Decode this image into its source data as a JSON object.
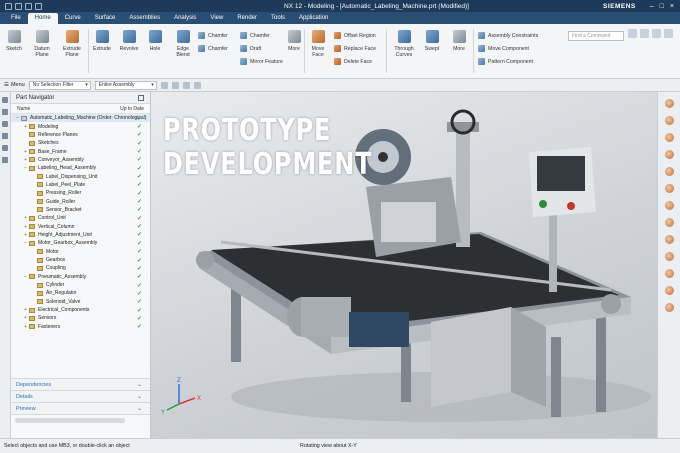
{
  "window": {
    "title": "NX 12 - Modeling - [Automatic_Labeling_Machine.prt (Modified)]",
    "brand": "SIEMENS"
  },
  "menu": {
    "tabs": [
      "File",
      "Home",
      "Curve",
      "Surface",
      "Assemblies",
      "Analysis",
      "View",
      "Render",
      "Tools",
      "Application"
    ],
    "active": "Home"
  },
  "ribbon": {
    "buttons": {
      "sketch": "Sketch",
      "datum": "Datum Plane",
      "extrude_plane": "Extrude Plane",
      "extrude": "Extrude",
      "revolve": "Revolve",
      "hole": "Hole",
      "edge_blend": "Edge Blend",
      "more1": "More",
      "move_face": "Move Face",
      "through_curves": "Through Curves",
      "swept": "Swept",
      "more2": "More"
    },
    "small": {
      "chamfer1": "Chamfer",
      "chamfer2": "Chamfer",
      "chamfer3": "Chamfer",
      "draft": "Draft",
      "mirror": "Mirror Feature",
      "offset_region": "Offset Region",
      "replace_face": "Replace Face",
      "delete_face": "Delete Face",
      "asm_constraints": "Assembly Constraints",
      "move_component": "Move Component",
      "pattern_component": "Pattern Component"
    },
    "search_placeholder": "Find a Command"
  },
  "selection": {
    "menu": "Menu",
    "filter": "No Selection Filter",
    "scope": "Entire Assembly"
  },
  "navigator": {
    "title": "Part Navigator",
    "col_name": "Name",
    "col_date": "Up to Date",
    "items": [
      {
        "label": "Automatic_Labeling_Machine (Order: Chronological)",
        "level": 0,
        "exp": "−",
        "type": "part"
      },
      {
        "label": "Modeling",
        "level": 1,
        "exp": "+",
        "type": "folder"
      },
      {
        "label": "Reference Planes",
        "level": 1,
        "exp": "",
        "type": "folder"
      },
      {
        "label": "Sketches",
        "level": 1,
        "exp": "",
        "type": "folder"
      },
      {
        "label": "Base_Frame",
        "level": 1,
        "exp": "+",
        "type": "folder"
      },
      {
        "label": "Conveyor_Assembly",
        "level": 1,
        "exp": "+",
        "type": "folder"
      },
      {
        "label": "Labeling_Head_Assembly",
        "level": 1,
        "exp": "−",
        "type": "folder"
      },
      {
        "label": "Label_Dispensing_Unit",
        "level": 2,
        "exp": "",
        "type": "folder"
      },
      {
        "label": "Label_Peel_Plate",
        "level": 2,
        "exp": "",
        "type": "folder"
      },
      {
        "label": "Pressing_Roller",
        "level": 2,
        "exp": "",
        "type": "folder"
      },
      {
        "label": "Guide_Roller",
        "level": 2,
        "exp": "",
        "type": "folder"
      },
      {
        "label": "Sensor_Bracket",
        "level": 2,
        "exp": "",
        "type": "folder"
      },
      {
        "label": "Control_Unit",
        "level": 1,
        "exp": "+",
        "type": "folder"
      },
      {
        "label": "Vertical_Column",
        "level": 1,
        "exp": "+",
        "type": "folder"
      },
      {
        "label": "Height_Adjustment_Unit",
        "level": 1,
        "exp": "+",
        "type": "folder"
      },
      {
        "label": "Motor_Gearbox_Assembly",
        "level": 1,
        "exp": "−",
        "type": "folder"
      },
      {
        "label": "Motor",
        "level": 2,
        "exp": "",
        "type": "folder"
      },
      {
        "label": "Gearbox",
        "level": 2,
        "exp": "",
        "type": "folder"
      },
      {
        "label": "Coupling",
        "level": 2,
        "exp": "",
        "type": "folder"
      },
      {
        "label": "Pneumatic_Assembly",
        "level": 1,
        "exp": "−",
        "type": "folder"
      },
      {
        "label": "Cylinder",
        "level": 2,
        "exp": "",
        "type": "folder"
      },
      {
        "label": "Air_Regulator",
        "level": 2,
        "exp": "",
        "type": "folder"
      },
      {
        "label": "Solenoid_Valve",
        "level": 2,
        "exp": "",
        "type": "folder"
      },
      {
        "label": "Electrical_Components",
        "level": 1,
        "exp": "+",
        "type": "folder"
      },
      {
        "label": "Sensors",
        "level": 1,
        "exp": "+",
        "type": "folder"
      },
      {
        "label": "Fasteners",
        "level": 1,
        "exp": "+",
        "type": "folder"
      }
    ],
    "panels": {
      "dependencies": "Dependencies",
      "details": "Details",
      "preview": "Preview"
    }
  },
  "viewport": {
    "headline1": "PROTOTYPE",
    "headline2": "DEVELOPMENT",
    "triad": {
      "x": "X",
      "y": "Y",
      "z": "Z"
    }
  },
  "status": {
    "left": "Select objects and use MB3, or double-click an object",
    "center": "Rotating view about X-Y"
  }
}
